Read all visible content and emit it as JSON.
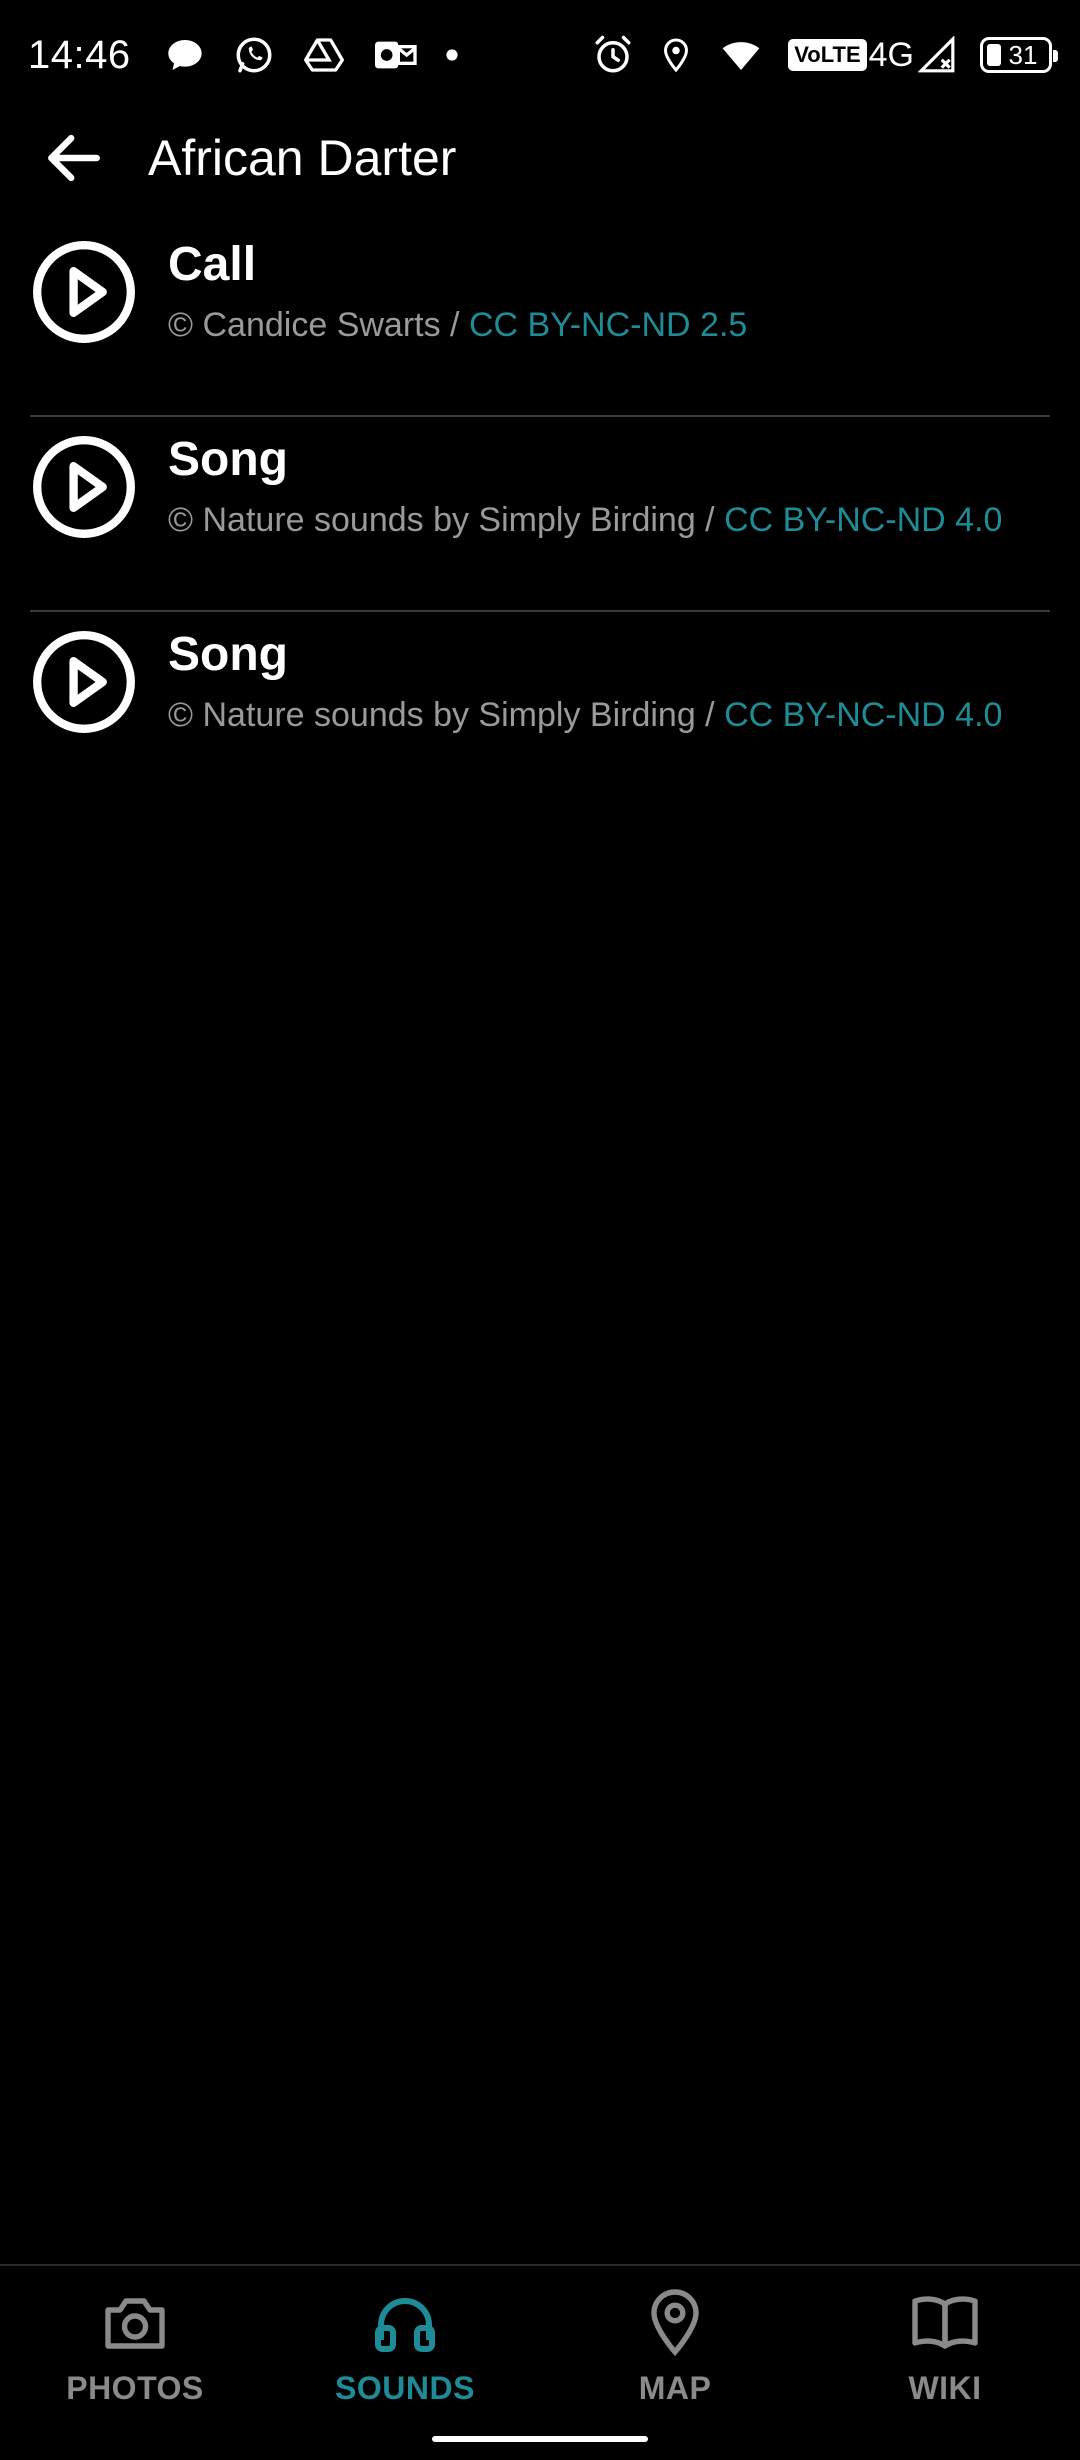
{
  "status_bar": {
    "time": "14:46",
    "network": "4G",
    "volte": "VoLTE",
    "battery": "31",
    "left_icons": [
      "chat-bubble-icon",
      "whatsapp-icon",
      "drive-icon",
      "outlook-icon",
      "dot-icon"
    ],
    "right_icons": [
      "alarm-icon",
      "location-icon",
      "wifi-icon",
      "volte-icon",
      "signal-icon",
      "battery-icon"
    ]
  },
  "header": {
    "title": "African Darter",
    "back_icon": "arrow-back-icon"
  },
  "sounds": [
    {
      "title": "Call",
      "credit": "© Candice Swarts / ",
      "license": "CC BY-NC-ND 2.5"
    },
    {
      "title": "Song",
      "credit": "© Nature sounds by Simply Birding / ",
      "license": "CC BY-NC-ND 4.0"
    },
    {
      "title": "Song",
      "credit": "© Nature sounds by Simply Birding / ",
      "license": "CC BY-NC-ND 4.0"
    }
  ],
  "bottom_nav": {
    "active": "SOUNDS",
    "items": [
      {
        "label": "PHOTOS",
        "icon": "camera-icon"
      },
      {
        "label": "SOUNDS",
        "icon": "headphones-icon"
      },
      {
        "label": "MAP",
        "icon": "map-pin-icon"
      },
      {
        "label": "WIKI",
        "icon": "book-icon"
      }
    ]
  },
  "colors": {
    "background": "#000000",
    "accent": "#1e8c96",
    "text_primary": "#ffffff",
    "text_secondary": "#9a9a9a",
    "nav_inactive": "#8a8a8a",
    "divider": "#3a3a3a"
  }
}
